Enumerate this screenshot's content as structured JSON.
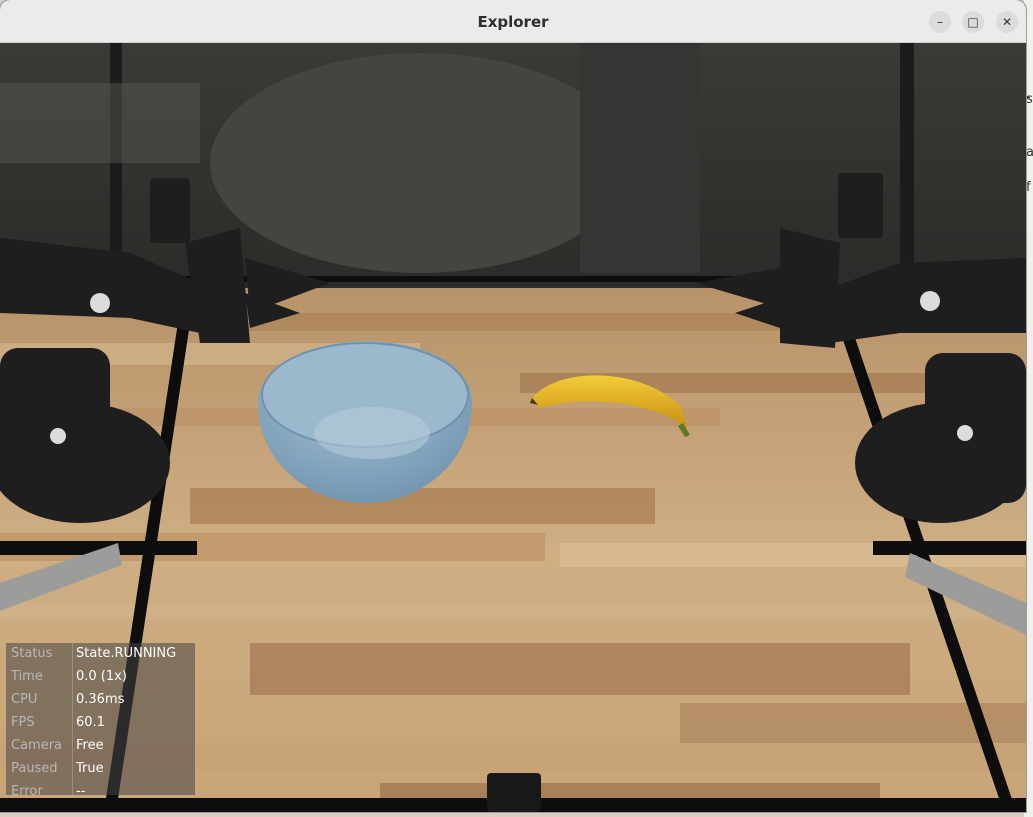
{
  "window": {
    "title": "Explorer",
    "controls": {
      "minimize": "–",
      "maximize": "□",
      "close": "✕"
    }
  },
  "background_window": {
    "fragments": [
      "-",
      "s",
      "a",
      "f"
    ]
  },
  "status_panel": {
    "rows": [
      {
        "key": "Status",
        "value": "State.RUNNING"
      },
      {
        "key": "Time",
        "value": "0.0 (1x)"
      },
      {
        "key": "CPU",
        "value": "0.36ms"
      },
      {
        "key": "FPS",
        "value": "60.1"
      },
      {
        "key": "Camera",
        "value": "Free"
      },
      {
        "key": "Paused",
        "value": "True"
      },
      {
        "key": "Error",
        "value": "--"
      }
    ]
  },
  "colors": {
    "bowl": "#8fb0c8",
    "banana": "#e8b820",
    "table_wood": "#c9a77a",
    "robot": "#1e1e1e"
  }
}
